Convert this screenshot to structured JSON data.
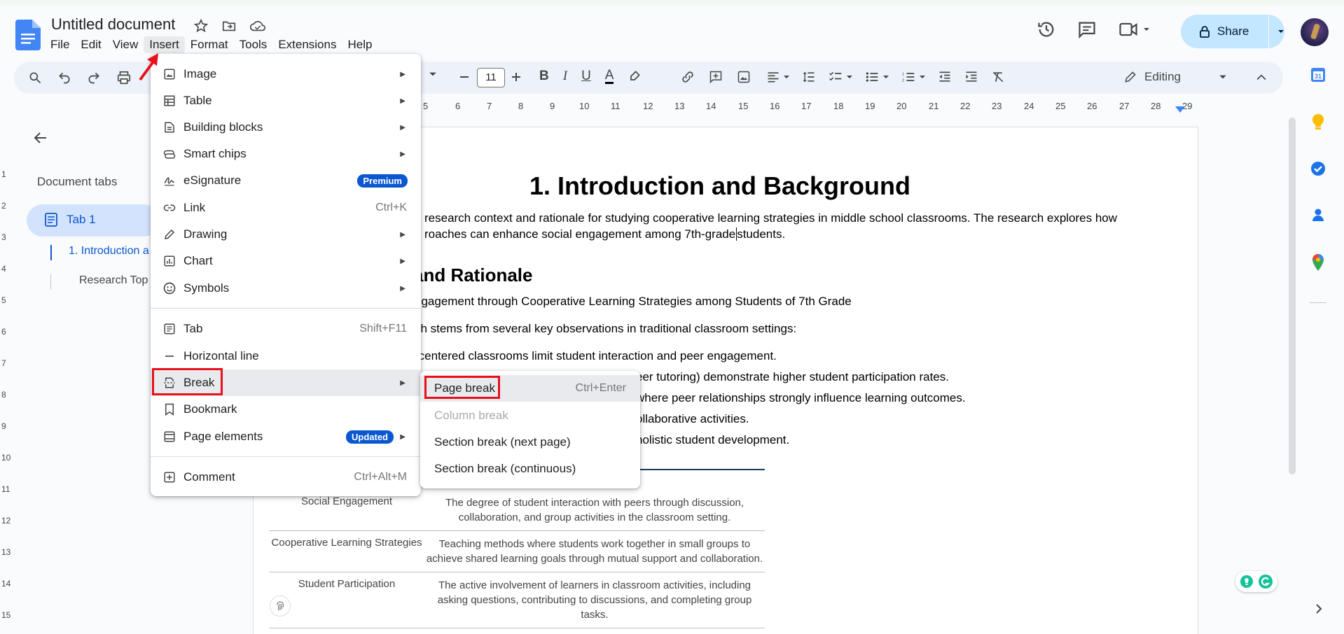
{
  "app": {
    "doc_title": "Untitled document",
    "menus": [
      "File",
      "Edit",
      "View",
      "Insert",
      "Format",
      "Tools",
      "Extensions",
      "Help"
    ],
    "share_label": "Share"
  },
  "toolbar": {
    "font_size": "11",
    "mode_label": "Editing"
  },
  "ruler": [
    "5",
    "6",
    "7",
    "8",
    "9",
    "10",
    "11",
    "12",
    "13",
    "14",
    "15",
    "16",
    "17",
    "18",
    "19",
    "20",
    "21",
    "22",
    "23",
    "24",
    "25",
    "26",
    "27",
    "28",
    "29"
  ],
  "vruler": [
    "1",
    "2",
    "3",
    "4",
    "5",
    "6",
    "7",
    "8",
    "9",
    "10",
    "11",
    "12",
    "13",
    "14",
    "15"
  ],
  "sidebar": {
    "heading": "Document tabs",
    "tab": "Tab 1",
    "outline": [
      "1. Introduction a",
      "Research Top"
    ]
  },
  "document": {
    "h1": "1. Introduction and Background",
    "p1_line1": "research context and rationale for studying cooperative learning strategies in middle school classrooms. The research explores how",
    "p1_line2a": "roaches can enhance social engagement among 7th-grade",
    "p1_line2b": "students.",
    "h2": "and Rationale",
    "p2": "ngagement through Cooperative Learning Strategies among Students of 7th Grade",
    "p3": "ch stems from several key observations in traditional classroom settings:",
    "bullet1": "-centered classrooms limit student interaction and peer engagement.",
    "bullet2": "eer tutoring) demonstrate higher student participation rates.",
    "bullet3": "where peer relationships strongly influence learning outcomes.",
    "bullet4": "ollaborative activities.",
    "bullet5": "holistic student development.",
    "table": [
      {
        "term": "Social Engagement",
        "def": "The degree of student interaction with peers through discussion, collaboration, and group activities in the classroom setting."
      },
      {
        "term": "Cooperative Learning Strategies",
        "def": "Teaching methods where students work together in small groups to achieve shared learning goals through mutual support and collaboration."
      },
      {
        "term": "Student Participation",
        "def": "The active involvement of learners in classroom activities, including asking questions, contributing to discussions, and completing group tasks."
      }
    ]
  },
  "insert_menu": {
    "items": [
      {
        "label": "Image"
      },
      {
        "label": "Table"
      },
      {
        "label": "Building blocks"
      },
      {
        "label": "Smart chips"
      },
      {
        "label": "eSignature",
        "badge": "Premium"
      },
      {
        "label": "Link",
        "shortcut": "Ctrl+K"
      },
      {
        "label": "Drawing"
      },
      {
        "label": "Chart"
      },
      {
        "label": "Symbols"
      },
      {
        "label": "Tab",
        "shortcut": "Shift+F11"
      },
      {
        "label": "Horizontal line"
      },
      {
        "label": "Break"
      },
      {
        "label": "Bookmark"
      },
      {
        "label": "Page elements",
        "badge": "Updated"
      },
      {
        "label": "Comment",
        "shortcut": "Ctrl+Alt+M"
      }
    ]
  },
  "break_submenu": {
    "items": [
      {
        "label": "Page break",
        "shortcut": "Ctrl+Enter"
      },
      {
        "label": "Column break"
      },
      {
        "label": "Section break (next page)"
      },
      {
        "label": "Section break (continuous)"
      }
    ]
  },
  "colors": {
    "accent": "#0b57d0",
    "share_bg": "#c2e7ff",
    "highlight_red": "#e8101a",
    "toolbar_bg": "#edf2fa"
  }
}
